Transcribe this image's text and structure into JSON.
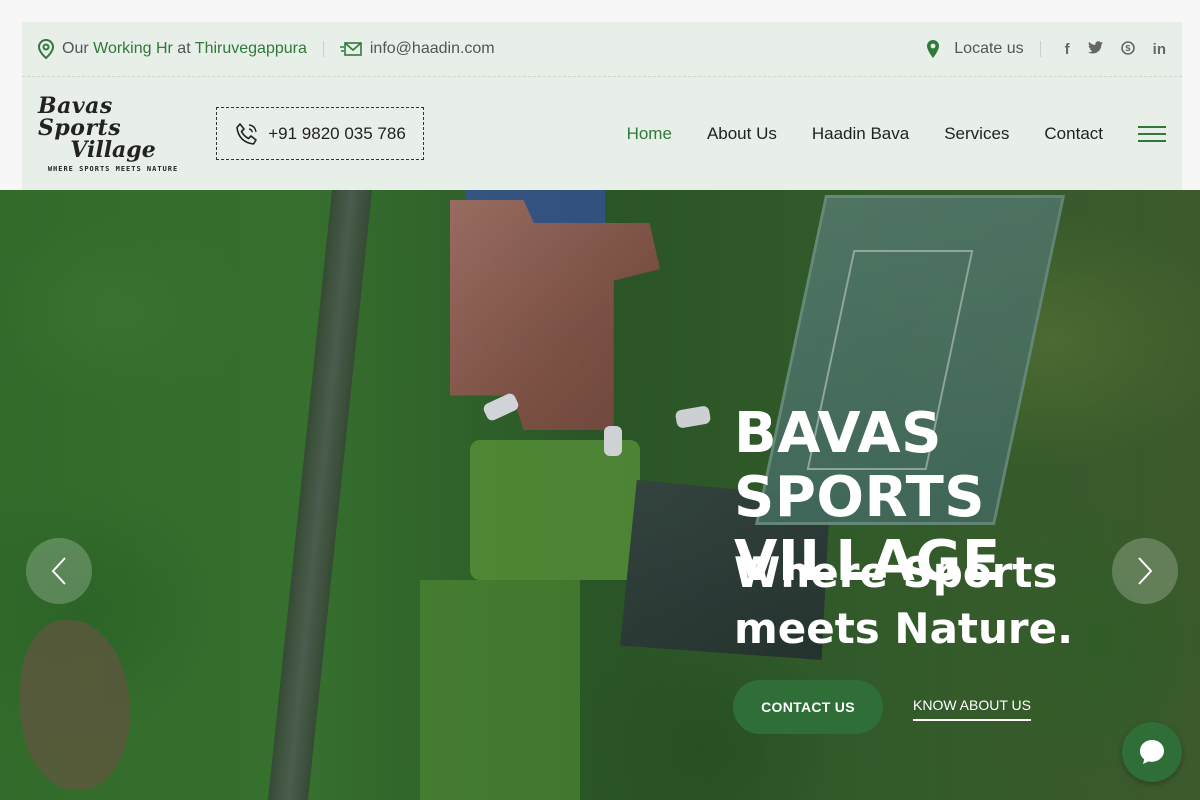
{
  "topbar": {
    "working_prefix": "Our",
    "working_hr": "Working Hr",
    "at": "at",
    "location": "Thiruvegappura",
    "email": "info@haadin.com",
    "locate": "Locate us",
    "social": [
      {
        "name": "facebook-icon",
        "glyph": "f"
      },
      {
        "name": "twitter-icon",
        "glyph": "t"
      },
      {
        "name": "skype-icon",
        "glyph": "s"
      },
      {
        "name": "linkedin-icon",
        "glyph": "in"
      }
    ]
  },
  "header": {
    "logo_line1": "Bavas Sports",
    "logo_line2": "Village",
    "logo_tagline": "WHERE SPORTS MEETS NATURE",
    "phone": "+91 9820 035 786",
    "nav": [
      {
        "label": "Home",
        "active": true
      },
      {
        "label": "About Us",
        "active": false
      },
      {
        "label": "Haadin Bava",
        "active": false
      },
      {
        "label": "Services",
        "active": false
      },
      {
        "label": "Contact",
        "active": false
      }
    ]
  },
  "hero": {
    "title_line1": "BAVAS SPORTS",
    "title_line2": "VILLAGE",
    "sub_line1": "Where Sports",
    "sub_line2": "meets Nature.",
    "contact_button": "CONTACT US",
    "know_button": "KNOW ABOUT US"
  },
  "colors": {
    "accent": "#2f7a3a",
    "button": "#2f6f37",
    "header_bg": "#e8efe8"
  }
}
